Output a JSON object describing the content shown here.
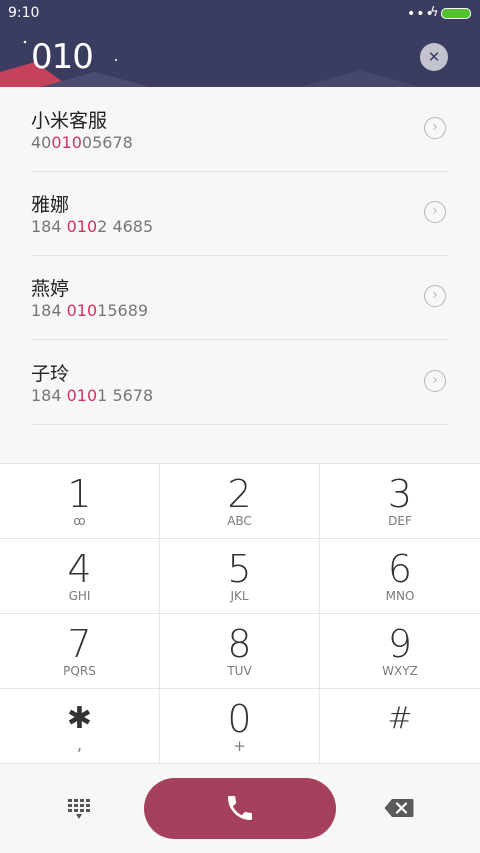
{
  "status_bar": {
    "time": "9:10",
    "dots": "•••",
    "bolt": "ϟ"
  },
  "search": {
    "query": "010",
    "clear_glyph": "✕"
  },
  "results": [
    {
      "name": "小米客服",
      "num_pre": "40",
      "num_hl": "010",
      "num_post": "05678"
    },
    {
      "name": "雅娜",
      "num_pre": "184 ",
      "num_hl": "010",
      "num_post": "2 4685"
    },
    {
      "name": "燕婷",
      "num_pre": "184 ",
      "num_hl": "010",
      "num_post": "15689"
    },
    {
      "name": "子玲",
      "num_pre": "184 ",
      "num_hl": "010",
      "num_post": "1 5678"
    }
  ],
  "keypad": [
    {
      "digit": "1",
      "letters": "ꝏ"
    },
    {
      "digit": "2",
      "letters": "ABC"
    },
    {
      "digit": "3",
      "letters": "DEF"
    },
    {
      "digit": "4",
      "letters": "GHI"
    },
    {
      "digit": "5",
      "letters": "JKL"
    },
    {
      "digit": "6",
      "letters": "MNO"
    },
    {
      "digit": "7",
      "letters": "PQRS"
    },
    {
      "digit": "8",
      "letters": "TUV"
    },
    {
      "digit": "9",
      "letters": "WXYZ"
    },
    {
      "digit": "✱",
      "letters": ","
    },
    {
      "digit": "0",
      "letters": "+"
    },
    {
      "digit": "#",
      "letters": ""
    }
  ],
  "colors": {
    "header_bg": "#3b3d60",
    "highlight": "#d23360",
    "call_button": "#a4405c",
    "battery": "#55c02d"
  }
}
